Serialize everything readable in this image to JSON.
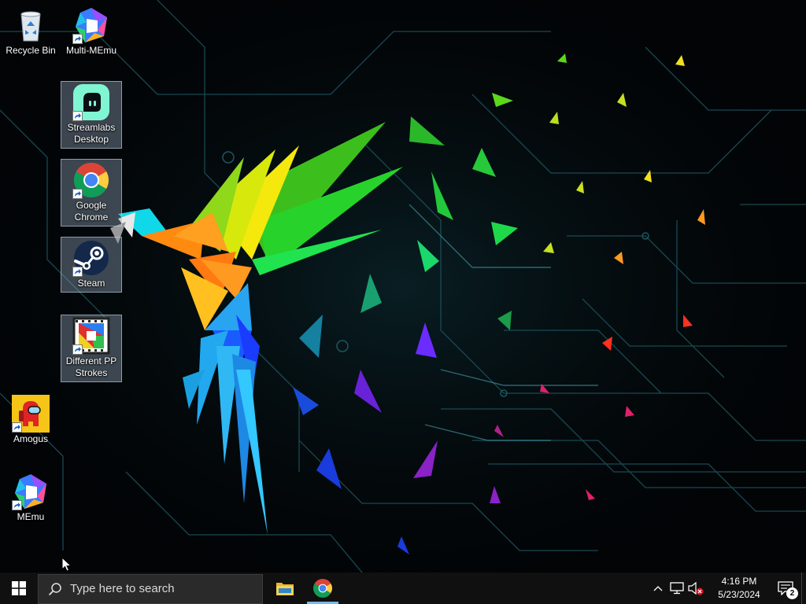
{
  "desktop": {
    "icons": [
      {
        "label": "Recycle Bin",
        "icon": "recycle-bin-icon"
      },
      {
        "label": "Multi-MEmu",
        "icon": "multi-memu-icon"
      },
      {
        "label": "Streamlabs Desktop",
        "icon": "streamlabs-icon"
      },
      {
        "label": "Google Chrome",
        "icon": "chrome-icon"
      },
      {
        "label": "Steam",
        "icon": "steam-icon"
      },
      {
        "label": "Different PP Strokes",
        "icon": "different-pp-strokes-icon"
      },
      {
        "label": "Amogus",
        "icon": "amogus-icon"
      },
      {
        "label": "MEmu",
        "icon": "memu-icon"
      }
    ]
  },
  "taskbar": {
    "search_placeholder": "Type here to search",
    "pinned_apps": [
      {
        "name": "File Explorer",
        "icon": "folder-icon"
      },
      {
        "name": "Google Chrome",
        "icon": "chrome-icon"
      }
    ],
    "tray": {
      "time": "4:16 PM",
      "date": "5/23/2024",
      "notification_count": "2"
    }
  },
  "colors": {
    "taskbar_bg": "#101010",
    "search_bg": "#2a2a2a",
    "active_indicator": "#76b9ed",
    "wallpaper_bg": "#020406",
    "circuit": "#1e5560"
  }
}
